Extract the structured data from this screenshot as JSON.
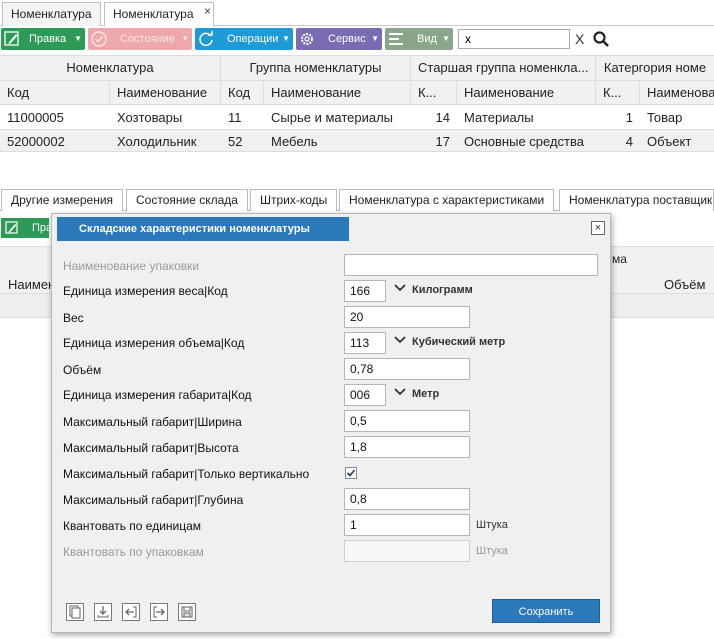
{
  "top_tabs": [
    {
      "label": "Номенклатура"
    },
    {
      "label": "Номенклатура"
    }
  ],
  "tab_close": "×",
  "toolbar": {
    "edit": "Правка",
    "state": "Состояние",
    "operations": "Операции",
    "service": "Сервис",
    "view": "Вид",
    "search_value": "x",
    "clear": "X"
  },
  "grid": {
    "groups": [
      "Номенклатура",
      "Группа номенклатуры",
      "Старшая группа номенкла...",
      "Катергория номе"
    ],
    "columns": [
      "Код",
      "Наименование",
      "Код",
      "Наименование",
      "К...",
      "Наименование",
      "К...",
      "Наименова"
    ],
    "rows": [
      [
        "11000005",
        "Хозтовары",
        "11",
        "Сырье и материалы",
        "14",
        "Материалы",
        "1",
        "Товар"
      ],
      [
        "52000002",
        "Холодильник",
        "52",
        "Мебель",
        "17",
        "Основные средства",
        "4",
        "Объект"
      ]
    ]
  },
  "bottom_tabs": [
    "Другие измерения",
    "Состояние склада",
    "Штрих-коды",
    "Номенклатура с характеристиками",
    "Номенклатура поставщик"
  ],
  "bg": {
    "edit": "Пра",
    "col_name": "Наимен",
    "col_ma": "ма",
    "col_volume": "Объём"
  },
  "dialog": {
    "title": "Складские характеристики номенклатуры",
    "close": "×",
    "fields": {
      "pack_name": {
        "label": "Наименование упаковки",
        "value": ""
      },
      "weight_unit": {
        "label": "Единица измерения веса|Код",
        "value": "166",
        "unit": "Килограмм"
      },
      "weight": {
        "label": "Вес",
        "value": "20"
      },
      "volume_unit": {
        "label": "Единица измерения объема|Код",
        "value": "113",
        "unit": "Кубический метр"
      },
      "volume": {
        "label": "Объём",
        "value": "0,78"
      },
      "dim_unit": {
        "label": "Единица измерения габарита|Код",
        "value": "006",
        "unit": "Метр"
      },
      "max_width": {
        "label": "Максимальный габарит|Ширина",
        "value": "0,5"
      },
      "max_height": {
        "label": "Максимальный габарит|Высота",
        "value": "1,8"
      },
      "vertical_only": {
        "label": "Максимальный габарит|Только вертикально",
        "checked": true
      },
      "max_depth": {
        "label": "Максимальный габарит|Глубина",
        "value": "0,8"
      },
      "quant_units": {
        "label": "Квантовать по единицам",
        "value": "1",
        "unit": "Штука"
      },
      "quant_packs": {
        "label": "Квантовать по упаковкам",
        "value": "",
        "unit": "Штука"
      }
    },
    "save": "Сохранить"
  }
}
